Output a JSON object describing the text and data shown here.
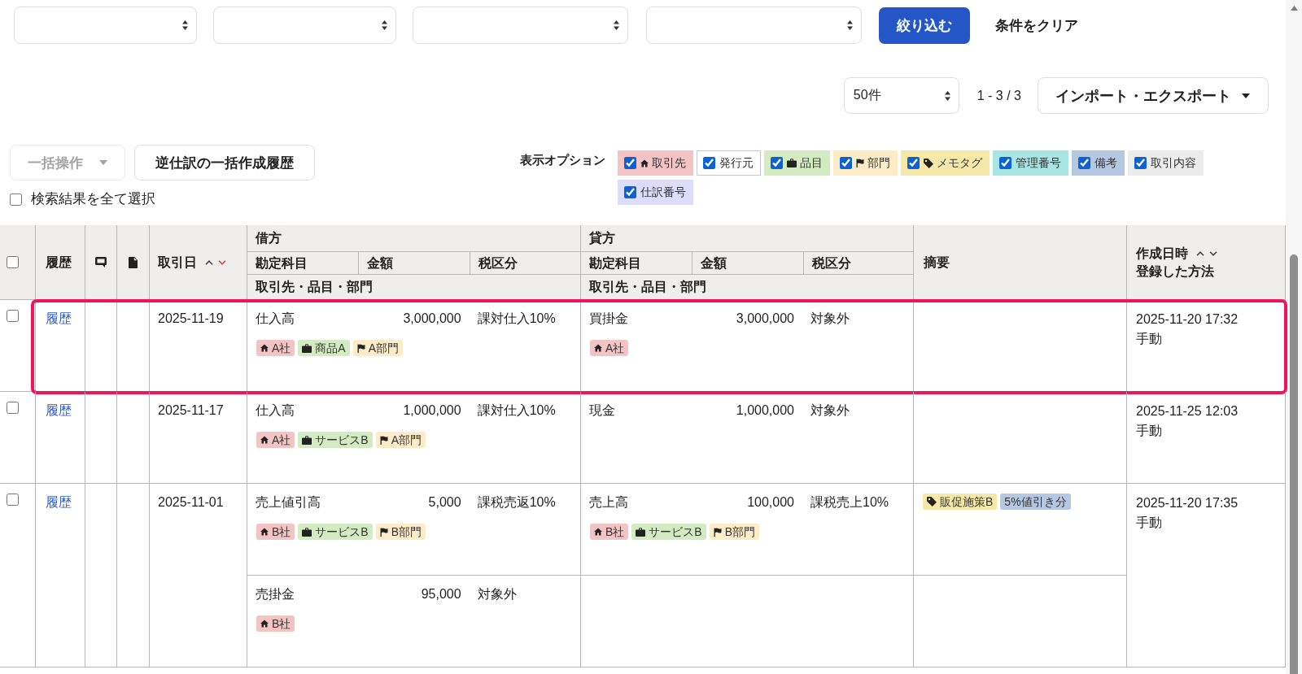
{
  "filters": {
    "dropdowns": [
      {
        "kind": "dropdown"
      },
      {
        "kind": "dropdown"
      },
      {
        "kind": "dropdown"
      },
      {
        "kind": "dropdown"
      }
    ],
    "apply_button": "絞り込む",
    "clear_button": "条件をクリア"
  },
  "pagination": {
    "per_page": "50件",
    "range": "1 - 3 / 3"
  },
  "import_export_button": "インポート・エクスポート",
  "bulk_actions": {
    "label": "一括操作",
    "disabled": true
  },
  "reverse_entry_history_button": "逆仕訳の一括作成履歴",
  "select_all_results": {
    "label": "検索結果を全て選択",
    "checked": false
  },
  "display_options": {
    "label": "表示オプション",
    "items": [
      {
        "kind": "partner",
        "label": "取引先",
        "checked": true,
        "color": "#f4c3c3"
      },
      {
        "kind": "issuer",
        "label": "発行元",
        "checked": true,
        "color": "#ffffff"
      },
      {
        "kind": "item",
        "label": "品目",
        "checked": true,
        "color": "#d3ebc1"
      },
      {
        "kind": "department",
        "label": "部門",
        "checked": true,
        "color": "#feecc9"
      },
      {
        "kind": "memo_tag",
        "label": "メモタグ",
        "checked": true,
        "color": "#f5e8a9"
      },
      {
        "kind": "management_number",
        "label": "管理番号",
        "checked": true,
        "color": "#a9e5e2"
      },
      {
        "kind": "note",
        "label": "備考",
        "checked": true,
        "color": "#b5c8e1"
      },
      {
        "kind": "description",
        "label": "取引内容",
        "checked": true,
        "color": "#ececec"
      },
      {
        "kind": "journal_number",
        "label": "仕訳番号",
        "checked": true,
        "color": "#dcdcfb"
      }
    ]
  },
  "table": {
    "header": {
      "select_all": {
        "checked": false
      },
      "history": "履歴",
      "date": {
        "label": "取引日",
        "sorted_ascending": false,
        "sorted_descending": true
      },
      "debit": {
        "label": "借方",
        "account": "勘定科目",
        "amount": "金額",
        "tax": "税区分",
        "tags": "取引先・品目・部門"
      },
      "credit": {
        "label": "貸方",
        "account": "勘定科目",
        "amount": "金額",
        "tax": "税区分",
        "tags": "取引先・品目・部門"
      },
      "memo": "摘要",
      "created": {
        "label": "作成日時",
        "sorted_ascending": false,
        "sorted_descending": false,
        "method": "登録した方法"
      }
    },
    "rows": [
      {
        "checked": false,
        "highlighted": true,
        "history_link": "履歴",
        "date": "2025-11-19",
        "lines": [
          {
            "debit": {
              "account": "仕入高",
              "amount": "3,000,000",
              "tax": "課対仕入10%",
              "tags": [
                {
                  "kind": "partner",
                  "label": "A社"
                },
                {
                  "kind": "item",
                  "label": "商品A"
                },
                {
                  "kind": "department",
                  "label": "A部門"
                }
              ]
            },
            "credit": {
              "account": "買掛金",
              "amount": "3,000,000",
              "tax": "対象外",
              "tags": [
                {
                  "kind": "partner",
                  "label": "A社"
                }
              ]
            }
          }
        ],
        "created_at": "2025-11-20 17:32",
        "method": "手動"
      },
      {
        "checked": false,
        "highlighted": false,
        "history_link": "履歴",
        "date": "2025-11-17",
        "lines": [
          {
            "debit": {
              "account": "仕入高",
              "amount": "1,000,000",
              "tax": "課対仕入10%",
              "tags": [
                {
                  "kind": "partner",
                  "label": "A社"
                },
                {
                  "kind": "item",
                  "label": "サービスB"
                },
                {
                  "kind": "department",
                  "label": "A部門"
                }
              ]
            },
            "credit": {
              "account": "現金",
              "amount": "1,000,000",
              "tax": "対象外"
            }
          }
        ],
        "created_at": "2025-11-25 12:03",
        "method": "手動"
      },
      {
        "checked": false,
        "highlighted": false,
        "history_link": "履歴",
        "date": "2025-11-01",
        "lines": [
          {
            "debit": {
              "account": "売上値引高",
              "amount": "5,000",
              "tax": "課税売返10%",
              "tags": [
                {
                  "kind": "partner",
                  "label": "B社"
                },
                {
                  "kind": "item",
                  "label": "サービスB"
                },
                {
                  "kind": "department",
                  "label": "B部門"
                }
              ]
            },
            "credit": {
              "account": "売上高",
              "amount": "100,000",
              "tax": "課税売上10%",
              "tags": [
                {
                  "kind": "partner",
                  "label": "B社"
                },
                {
                  "kind": "item",
                  "label": "サービスB"
                },
                {
                  "kind": "department",
                  "label": "B部門"
                }
              ]
            },
            "memo_tags": [
              {
                "kind": "memo_tag",
                "label": "販促施策B"
              },
              {
                "kind": "note",
                "label": "5%値引き分"
              }
            ]
          },
          {
            "debit": {
              "account": "売掛金",
              "amount": "95,000",
              "tax": "対象外",
              "tags": [
                {
                  "kind": "partner",
                  "label": "B社"
                }
              ]
            }
          }
        ],
        "created_at": "2025-11-20 17:35",
        "method": "手動"
      }
    ]
  }
}
